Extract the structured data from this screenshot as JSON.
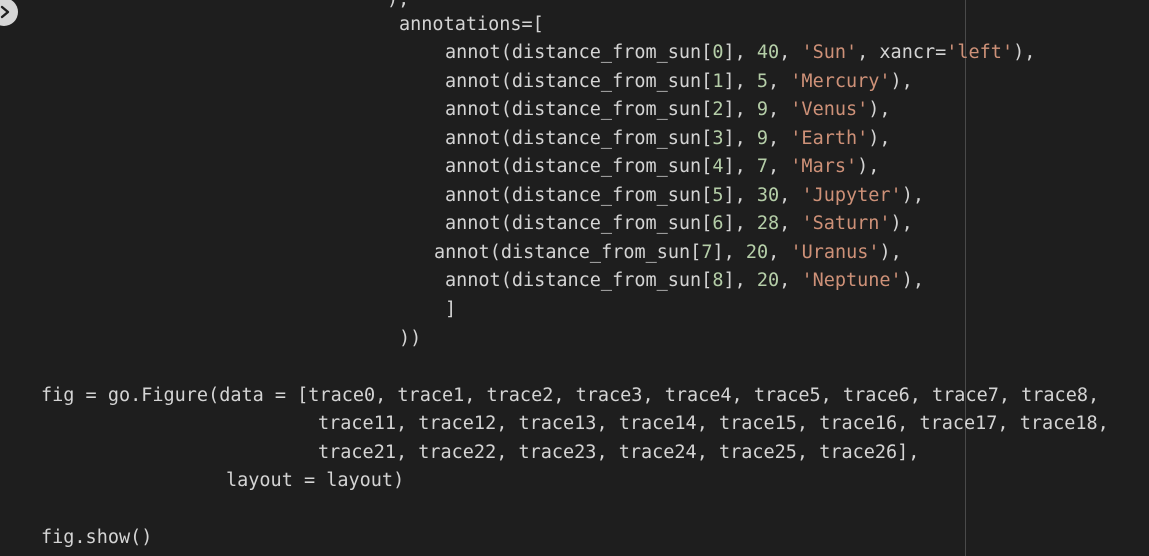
{
  "editor": {
    "run_button_icon": "play-icon",
    "lines": [
      {
        "id": "l0",
        "segments": [
          {
            "t": ")",
            "k": "txt"
          },
          {
            "t": ",",
            "k": "txt"
          }
        ]
      },
      {
        "id": "l1",
        "segments": [
          {
            "t": "annotations=[",
            "k": "txt"
          }
        ]
      },
      {
        "id": "l2",
        "segments": [
          {
            "t": "annot(distance_from_sun[",
            "k": "txt"
          },
          {
            "t": "0",
            "k": "num"
          },
          {
            "t": "], ",
            "k": "txt"
          },
          {
            "t": "40",
            "k": "num"
          },
          {
            "t": ", ",
            "k": "txt"
          },
          {
            "t": "'Sun'",
            "k": "str"
          },
          {
            "t": ", xancr=",
            "k": "txt"
          },
          {
            "t": "'left'",
            "k": "str"
          },
          {
            "t": "),",
            "k": "txt"
          }
        ]
      },
      {
        "id": "l3",
        "segments": [
          {
            "t": "annot(distance_from_sun[",
            "k": "txt"
          },
          {
            "t": "1",
            "k": "num"
          },
          {
            "t": "], ",
            "k": "txt"
          },
          {
            "t": "5",
            "k": "num"
          },
          {
            "t": ", ",
            "k": "txt"
          },
          {
            "t": "'Mercury'",
            "k": "str"
          },
          {
            "t": "),",
            "k": "txt"
          }
        ]
      },
      {
        "id": "l4",
        "segments": [
          {
            "t": "annot(distance_from_sun[",
            "k": "txt"
          },
          {
            "t": "2",
            "k": "num"
          },
          {
            "t": "], ",
            "k": "txt"
          },
          {
            "t": "9",
            "k": "num"
          },
          {
            "t": ", ",
            "k": "txt"
          },
          {
            "t": "'Venus'",
            "k": "str"
          },
          {
            "t": "),",
            "k": "txt"
          }
        ]
      },
      {
        "id": "l5",
        "segments": [
          {
            "t": "annot(distance_from_sun[",
            "k": "txt"
          },
          {
            "t": "3",
            "k": "num"
          },
          {
            "t": "], ",
            "k": "txt"
          },
          {
            "t": "9",
            "k": "num"
          },
          {
            "t": ", ",
            "k": "txt"
          },
          {
            "t": "'Earth'",
            "k": "str"
          },
          {
            "t": "),",
            "k": "txt"
          }
        ]
      },
      {
        "id": "l6",
        "segments": [
          {
            "t": "annot(distance_from_sun[",
            "k": "txt"
          },
          {
            "t": "4",
            "k": "num"
          },
          {
            "t": "], ",
            "k": "txt"
          },
          {
            "t": "7",
            "k": "num"
          },
          {
            "t": ", ",
            "k": "txt"
          },
          {
            "t": "'Mars'",
            "k": "str"
          },
          {
            "t": "),",
            "k": "txt"
          }
        ]
      },
      {
        "id": "l7",
        "segments": [
          {
            "t": "annot(distance_from_sun[",
            "k": "txt"
          },
          {
            "t": "5",
            "k": "num"
          },
          {
            "t": "], ",
            "k": "txt"
          },
          {
            "t": "30",
            "k": "num"
          },
          {
            "t": ", ",
            "k": "txt"
          },
          {
            "t": "'Jupyter'",
            "k": "str"
          },
          {
            "t": "),",
            "k": "txt"
          }
        ]
      },
      {
        "id": "l8",
        "segments": [
          {
            "t": "annot(distance_from_sun[",
            "k": "txt"
          },
          {
            "t": "6",
            "k": "num"
          },
          {
            "t": "], ",
            "k": "txt"
          },
          {
            "t": "28",
            "k": "num"
          },
          {
            "t": ", ",
            "k": "txt"
          },
          {
            "t": "'Saturn'",
            "k": "str"
          },
          {
            "t": "),",
            "k": "txt"
          }
        ]
      },
      {
        "id": "l9",
        "segments": [
          {
            "t": "annot(distance_from_sun[",
            "k": "txt"
          },
          {
            "t": "7",
            "k": "num"
          },
          {
            "t": "], ",
            "k": "txt"
          },
          {
            "t": "20",
            "k": "num"
          },
          {
            "t": ", ",
            "k": "txt"
          },
          {
            "t": "'Uranus'",
            "k": "str"
          },
          {
            "t": "),",
            "k": "txt"
          }
        ]
      },
      {
        "id": "l10",
        "segments": [
          {
            "t": "annot(distance_from_sun[",
            "k": "txt"
          },
          {
            "t": "8",
            "k": "num"
          },
          {
            "t": "], ",
            "k": "txt"
          },
          {
            "t": "20",
            "k": "num"
          },
          {
            "t": ", ",
            "k": "txt"
          },
          {
            "t": "'Neptune'",
            "k": "str"
          },
          {
            "t": "),",
            "k": "txt"
          }
        ]
      },
      {
        "id": "l11",
        "segments": [
          {
            "t": "]",
            "k": "txt"
          }
        ]
      },
      {
        "id": "l12",
        "segments": [
          {
            "t": "))",
            "k": "txt"
          }
        ]
      },
      {
        "id": "l13",
        "segments": [
          {
            "t": "fig = go.Figure(data = [trace0, trace1, trace2, trace3, trace4, trace5, trace6, trace7, trace8,",
            "k": "txt"
          }
        ]
      },
      {
        "id": "l14",
        "segments": [
          {
            "t": "trace11, trace12, trace13, trace14, trace15, trace16, trace17, trace18,",
            "k": "txt"
          }
        ]
      },
      {
        "id": "l15",
        "segments": [
          {
            "t": "trace21, trace22, trace23, trace24, trace25, trace26],",
            "k": "txt"
          }
        ]
      },
      {
        "id": "l16",
        "segments": [
          {
            "t": "layout = layout)",
            "k": "txt"
          }
        ]
      },
      {
        "id": "l17",
        "segments": [
          {
            "t": "fig.show()",
            "k": "txt"
          }
        ]
      }
    ]
  },
  "colors": {
    "background": "#1e1e1e",
    "text": "#d4d4d4",
    "string": "#ce9178",
    "number": "#b5cea8",
    "ruler": "#4a4a4a"
  }
}
